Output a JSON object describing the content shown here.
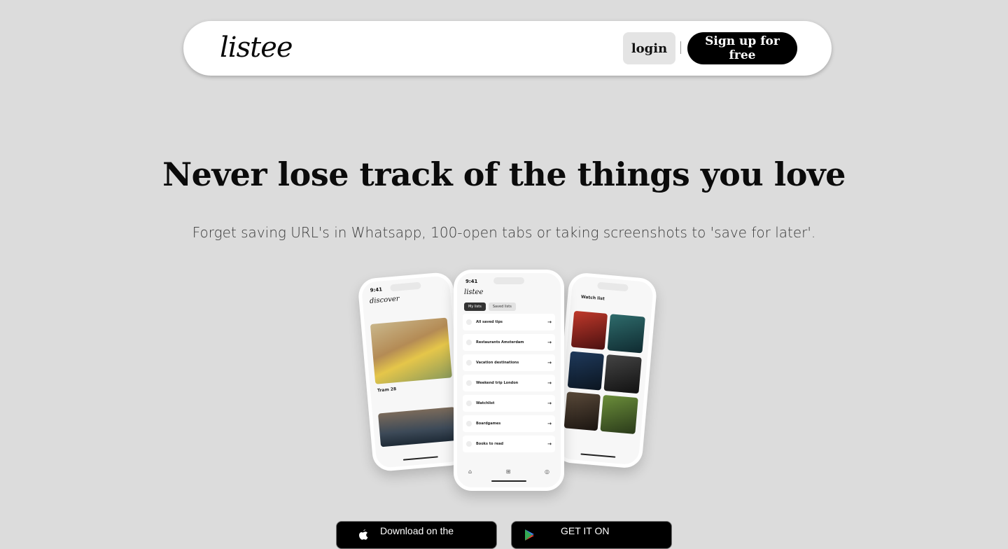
{
  "nav": {
    "logo": "listee",
    "login_label": "login",
    "signup_label": "Sign up for free"
  },
  "hero": {
    "title": "Never lose track of the things you love",
    "subtitle": "Forget saving URL's in Whatsapp, 100-open tabs or taking screenshots to 'save for later'."
  },
  "phone_center": {
    "time": "9:41",
    "logo": "listee",
    "tabs": [
      "My lists",
      "Saved lists"
    ],
    "items": [
      "All saved tips",
      "Restaurants Amsterdam",
      "Vacation destinations",
      "Weekend trip London",
      "Watchlist",
      "Boardgames",
      "Books to read"
    ]
  },
  "phone_left": {
    "time": "9:41",
    "logo": "discover",
    "caption": "Tram 28"
  },
  "phone_right": {
    "title": "Watch list"
  },
  "store": {
    "apple_label": "Download on the",
    "google_label": "GET IT ON"
  },
  "colors": {
    "background": "#dcdcdc",
    "primary_button": "#000000",
    "secondary_button": "#e4e4e4"
  }
}
